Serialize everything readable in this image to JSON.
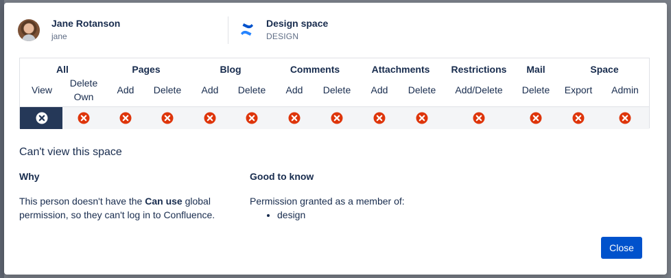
{
  "user": {
    "name": "Jane Rotanson",
    "handle": "jane"
  },
  "space": {
    "name": "Design space",
    "key": "DESIGN",
    "logo_icon": "confluence-logo-icon"
  },
  "colors": {
    "accent": "#0052cc",
    "deny": "#de350b",
    "selected_cell": "#253858"
  },
  "permissions": {
    "groups": [
      {
        "label": "All"
      },
      {
        "label": "Pages"
      },
      {
        "label": "Blog"
      },
      {
        "label": "Comments"
      },
      {
        "label": "Attachments"
      },
      {
        "label": "Restrictions"
      },
      {
        "label": "Mail"
      },
      {
        "label": "Space"
      }
    ],
    "columns": [
      {
        "label": "View",
        "status": "denied"
      },
      {
        "label": "Delete Own",
        "status": "denied"
      },
      {
        "label": "Add",
        "status": "denied"
      },
      {
        "label": "Delete",
        "status": "denied"
      },
      {
        "label": "Add",
        "status": "denied"
      },
      {
        "label": "Delete",
        "status": "denied"
      },
      {
        "label": "Add",
        "status": "denied"
      },
      {
        "label": "Delete",
        "status": "denied"
      },
      {
        "label": "Add",
        "status": "denied"
      },
      {
        "label": "Delete",
        "status": "denied"
      },
      {
        "label": "Add/Delete",
        "status": "denied"
      },
      {
        "label": "Delete",
        "status": "denied"
      },
      {
        "label": "Export",
        "status": "denied"
      },
      {
        "label": "Admin",
        "status": "denied"
      }
    ],
    "selected_column": "View"
  },
  "detail": {
    "title": "Can't view this space",
    "why_heading": "Why",
    "why_text_1": "This person doesn't have the ",
    "why_text_bold": "Can use",
    "why_text_2": " global permission, so they can't log in to Confluence.",
    "good_heading": "Good to know",
    "good_text": "Permission granted as a member of:",
    "good_items": [
      "design"
    ]
  },
  "actions": {
    "close_label": "Close"
  }
}
